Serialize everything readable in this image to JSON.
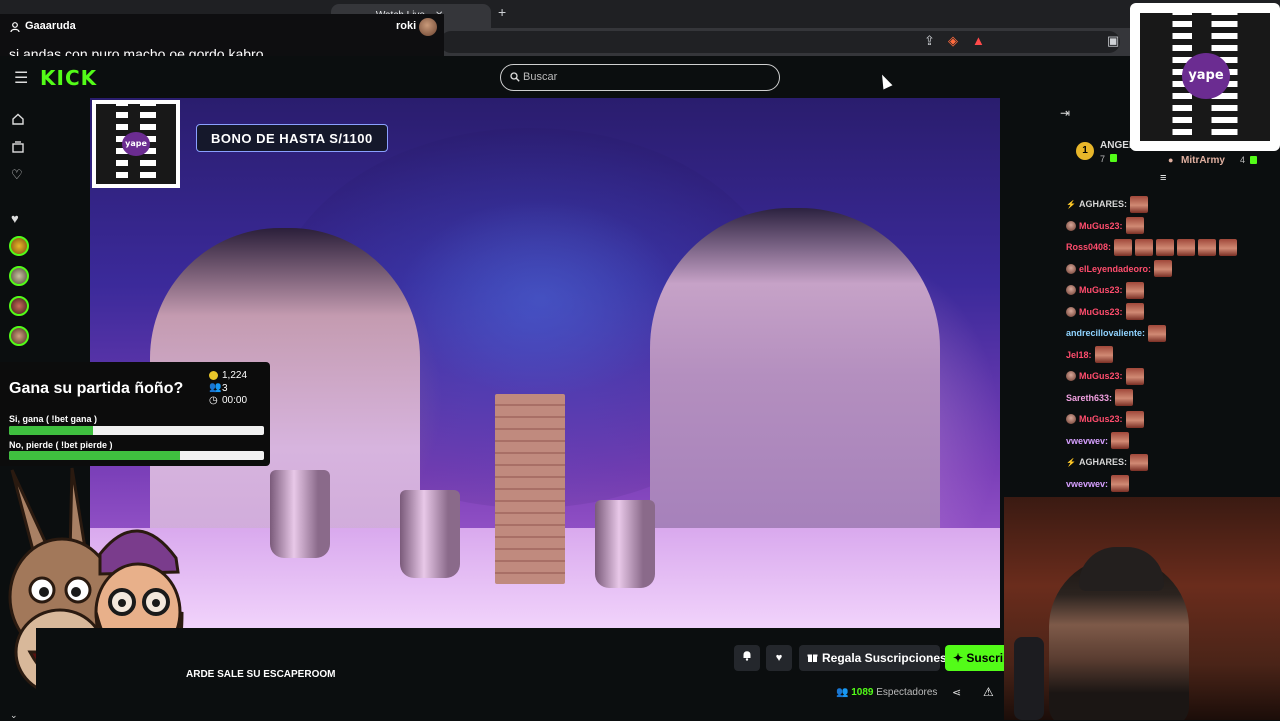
{
  "browser": {
    "tabs": [
      {
        "label": "",
        "active": false
      },
      {
        "label": "",
        "active": false
      },
      {
        "label": "Watch Live",
        "active": true
      }
    ],
    "new_tab_symbol": "+",
    "close_symbol": "✕"
  },
  "overlay_message": {
    "username": "Gaaaruda",
    "recipient": "roki",
    "text": "si andas con puro macho oe gordo kabro"
  },
  "kick": {
    "logo": "KICK",
    "search_placeholder": "Buscar"
  },
  "video_overlay": {
    "bono_text": "BONO DE HASTA S/1100",
    "qr_brand": "yape"
  },
  "poll": {
    "question": "Gana su partida ñoño?",
    "coins": "1,224",
    "participants": "3",
    "timer": "00:00",
    "options": [
      {
        "label": "Si, gana ( !bet gana )",
        "fraction": 0.33
      },
      {
        "label": "No, pierde ( !bet pierde )",
        "fraction": 0.67
      }
    ]
  },
  "stream": {
    "title_fragment": "ARDE SALE SU ESCAPEROOM",
    "gift_button": "Regala Suscripciones",
    "subscribe_button": "Suscrib",
    "viewers_count": "1089",
    "viewers_label": "Espectadores"
  },
  "chat": {
    "gift_leaders": [
      {
        "rank": "1",
        "name": "ANGEL",
        "count": "7"
      },
      {
        "rank": "",
        "name": "MitrArmy",
        "count": "4"
      }
    ],
    "messages": [
      {
        "user": "AGHARES:",
        "color": "#d6d6d6",
        "badge": "lightning",
        "emotes": 1
      },
      {
        "user": "MuGus23:",
        "color": "#ff4d6d",
        "badge": "avatar",
        "emotes": 1
      },
      {
        "user": "Ross0408:",
        "color": "#ff4d6d",
        "badge": "",
        "emotes": 6
      },
      {
        "user": "elLeyendadeoro:",
        "color": "#ff4d6d",
        "badge": "avatar",
        "emotes": 1
      },
      {
        "user": "MuGus23:",
        "color": "#ff4d6d",
        "badge": "avatar",
        "emotes": 1
      },
      {
        "user": "MuGus23:",
        "color": "#ff4d6d",
        "badge": "avatar",
        "emotes": 1
      },
      {
        "user": "andrecillovaliente:",
        "color": "#8fd3ff",
        "badge": "",
        "emotes": 1
      },
      {
        "user": "Jel18:",
        "color": "#ff4d6d",
        "badge": "",
        "emotes": 1
      },
      {
        "user": "MuGus23:",
        "color": "#ff4d6d",
        "badge": "avatar",
        "emotes": 1
      },
      {
        "user": "Sareth633:",
        "color": "#f0a0e0",
        "badge": "",
        "emotes": 1
      },
      {
        "user": "MuGus23:",
        "color": "#ff4d6d",
        "badge": "avatar",
        "emotes": 1
      },
      {
        "user": "vwevwev:",
        "color": "#d6a0ff",
        "badge": "",
        "emotes": 1
      },
      {
        "user": "AGHARES:",
        "color": "#d6d6d6",
        "badge": "lightning",
        "emotes": 1
      },
      {
        "user": "vwevwev:",
        "color": "#d6a0ff",
        "badge": "",
        "emotes": 1
      }
    ]
  },
  "colors": {
    "kick_green": "#53fc18",
    "yape_purple": "#6b2c91"
  }
}
